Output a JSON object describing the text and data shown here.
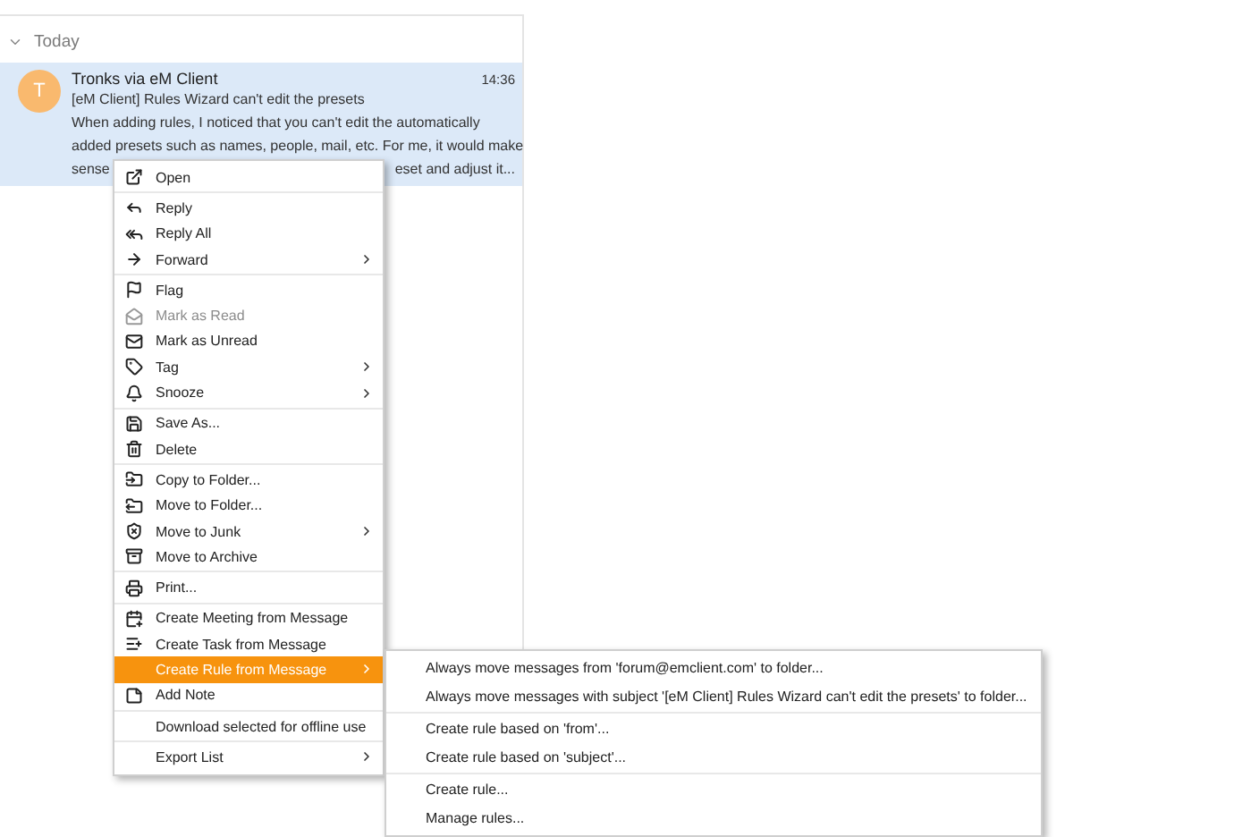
{
  "group": {
    "label": "Today",
    "expanded": true
  },
  "message": {
    "avatar": "T",
    "sender": "Tronks via eM Client",
    "time": "14:36",
    "subject": "[eM Client] Rules Wizard can't edit the presets",
    "preview_1": "When adding rules, I noticed that you can't edit the automatically",
    "preview_2": "added presets such as names, people, mail, etc. For me, it would make",
    "preview_3a": "sense",
    "preview_3b": "eset and adjust it...",
    "selected": true
  },
  "context_menu": [
    [
      {
        "label": "Open",
        "disabled": false,
        "selected": false,
        "has_submenu": false
      }
    ],
    [
      {
        "label": "Reply",
        "disabled": false,
        "selected": false,
        "has_submenu": false
      },
      {
        "label": "Reply All",
        "disabled": false,
        "selected": false,
        "has_submenu": false
      },
      {
        "label": "Forward",
        "disabled": false,
        "selected": false,
        "has_submenu": true
      }
    ],
    [
      {
        "label": "Flag",
        "disabled": false,
        "selected": false,
        "has_submenu": false
      },
      {
        "label": "Mark as Read",
        "disabled": true,
        "selected": false,
        "has_submenu": false
      },
      {
        "label": "Mark as Unread",
        "disabled": false,
        "selected": false,
        "has_submenu": false
      },
      {
        "label": "Tag",
        "disabled": false,
        "selected": false,
        "has_submenu": true
      },
      {
        "label": "Snooze",
        "disabled": false,
        "selected": false,
        "has_submenu": true
      }
    ],
    [
      {
        "label": "Save As...",
        "disabled": false,
        "selected": false,
        "has_submenu": false
      },
      {
        "label": "Delete",
        "disabled": false,
        "selected": false,
        "has_submenu": false
      }
    ],
    [
      {
        "label": "Copy to Folder...",
        "disabled": false,
        "selected": false,
        "has_submenu": false
      },
      {
        "label": "Move to Folder...",
        "disabled": false,
        "selected": false,
        "has_submenu": false
      },
      {
        "label": "Move to Junk",
        "disabled": false,
        "selected": false,
        "has_submenu": true
      },
      {
        "label": "Move to Archive",
        "disabled": false,
        "selected": false,
        "has_submenu": false
      }
    ],
    [
      {
        "label": "Print...",
        "disabled": false,
        "selected": false,
        "has_submenu": false
      }
    ],
    [
      {
        "label": "Create Meeting from Message",
        "disabled": false,
        "selected": false,
        "has_submenu": false
      },
      {
        "label": "Create Task from Message",
        "disabled": false,
        "selected": false,
        "has_submenu": false
      },
      {
        "label": "Create Rule from Message",
        "disabled": false,
        "selected": true,
        "has_submenu": true
      },
      {
        "label": "Add Note",
        "disabled": false,
        "selected": false,
        "has_submenu": false
      }
    ],
    [
      {
        "label": "Download selected for offline use",
        "disabled": false,
        "selected": false,
        "has_submenu": false
      }
    ],
    [
      {
        "label": "Export List",
        "disabled": false,
        "selected": false,
        "has_submenu": true
      }
    ]
  ],
  "submenu": [
    [
      "Always move messages from 'forum@emclient.com' to folder...",
      "Always move messages with subject '[eM Client] Rules Wizard can't edit the presets' to folder..."
    ],
    [
      "Create rule based on 'from'...",
      "Create rule based on 'subject'..."
    ],
    [
      "Create rule...",
      "Manage rules..."
    ]
  ]
}
